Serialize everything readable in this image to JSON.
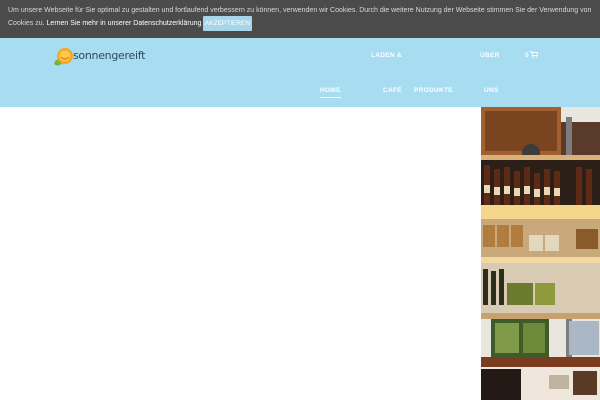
{
  "cookie_bar": {
    "line1": "Um unsere Webseite für Sie optimal zu gestalten und fortlaufend verbessern zu können, verwenden wir Cookies. Durch die weitere Nutzung der Webseite stimmen Sie der Verwendung von",
    "line2": "Cookies zu.",
    "more_link": "Lernen Sie mehr in unserer Datenschutzerklärung",
    "accept_label": "AKZEPTIEREN"
  },
  "header": {
    "logo_text": "sonnengereift",
    "nav_top": [
      "LADEN & ",
      "ÜBER"
    ],
    "nav_bottom": [
      "HOME",
      "CAFÉ",
      "PRODUKTE",
      "UNS"
    ],
    "cart_count": "0",
    "cart_icon": "shopping-cart-icon"
  },
  "colors": {
    "cookie_bg": "#4b4b4b",
    "header_bg": "#a7dcf1",
    "accent": "#a7d5ea",
    "logo_orange": "#f5a623",
    "logo_green": "#6fb43f"
  }
}
